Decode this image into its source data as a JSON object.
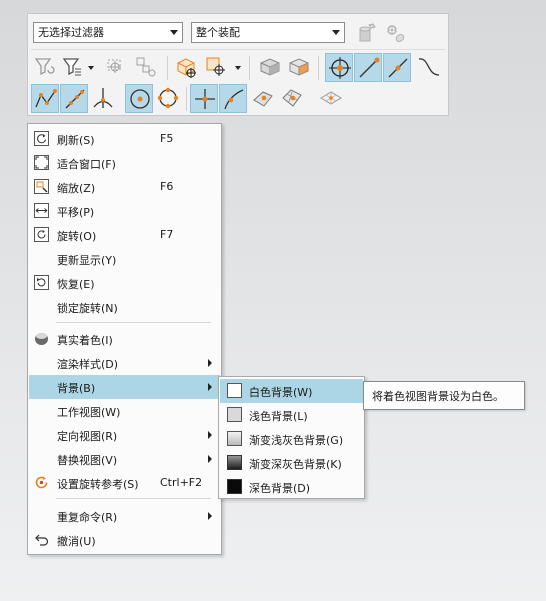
{
  "toolbar": {
    "filter_combo": "无选择过滤器",
    "scope_combo": "整个装配"
  },
  "colors": {
    "highlight": "#acd6e5",
    "toolbar_active": "#b5d9e8",
    "snap_orange": "#e8821e"
  },
  "context_menu": {
    "items": [
      {
        "label": "刷新(S)",
        "shortcut": "F5",
        "icon": "refresh-icon"
      },
      {
        "label": "适合窗口(F)",
        "shortcut": "",
        "icon": "fit-window-icon"
      },
      {
        "label": "缩放(Z)",
        "shortcut": "F6",
        "icon": "zoom-icon"
      },
      {
        "label": "平移(P)",
        "shortcut": "",
        "icon": "pan-icon"
      },
      {
        "label": "旋转(O)",
        "shortcut": "F7",
        "icon": "rotate-icon"
      },
      {
        "label": "更新显示(Y)",
        "shortcut": "",
        "icon": ""
      },
      {
        "label": "恢复(E)",
        "shortcut": "",
        "icon": "restore-icon"
      },
      {
        "label": "锁定旋转(N)",
        "shortcut": "",
        "icon": ""
      },
      {
        "label": "真实着色(I)",
        "shortcut": "",
        "icon": "true-shading-icon"
      },
      {
        "label": "渲染样式(D)",
        "shortcut": "",
        "icon": ""
      },
      {
        "label": "背景(B)",
        "shortcut": "",
        "icon": ""
      },
      {
        "label": "工作视图(W)",
        "shortcut": "",
        "icon": ""
      },
      {
        "label": "定向视图(R)",
        "shortcut": "",
        "icon": ""
      },
      {
        "label": "替换视图(V)",
        "shortcut": "",
        "icon": ""
      },
      {
        "label": "设置旋转参考(S)",
        "shortcut": "Ctrl+F2",
        "icon": "rotate-reference-icon"
      },
      {
        "label": "重复命令(R)",
        "shortcut": "",
        "icon": ""
      },
      {
        "label": "撤消(U)",
        "shortcut": "",
        "icon": "undo-icon"
      }
    ]
  },
  "background_submenu": {
    "items": [
      {
        "label": "白色背景(W)",
        "icon": "white-background-icon"
      },
      {
        "label": "浅色背景(L)",
        "icon": "light-background-icon"
      },
      {
        "label": "渐变浅灰色背景(G)",
        "icon": "gradient-light-gray-icon"
      },
      {
        "label": "渐变深灰色背景(K)",
        "icon": "gradient-dark-gray-icon"
      },
      {
        "label": "深色背景(D)",
        "icon": "dark-background-icon"
      }
    ]
  },
  "tooltip": {
    "text": "将着色视图背景设为白色。"
  }
}
